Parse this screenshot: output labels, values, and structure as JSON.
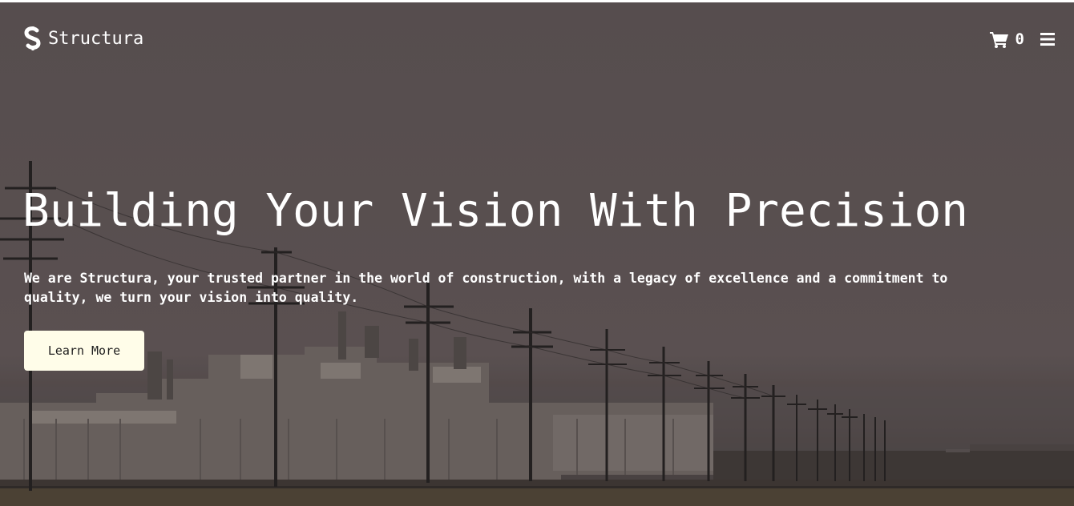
{
  "brand": {
    "name": "Structura",
    "logo_icon": "s-monogram-icon"
  },
  "nav": {
    "cart_icon": "shopping-cart-icon",
    "cart_count": "0",
    "menu_icon": "hamburger-menu-icon"
  },
  "hero": {
    "title": "Building Your Vision With Precision",
    "subtitle": "We are Structura, your trusted partner in the world of construction, with a legacy of excellence and a commitment to quality, we turn your vision into quality.",
    "cta_label": "Learn More",
    "background_image": "industrial plant with power line poles under overcast sky"
  },
  "colors": {
    "overlay": "#5c5354",
    "text": "#ffffff",
    "button_bg": "#fffde9",
    "button_text": "#1e1e1e"
  }
}
